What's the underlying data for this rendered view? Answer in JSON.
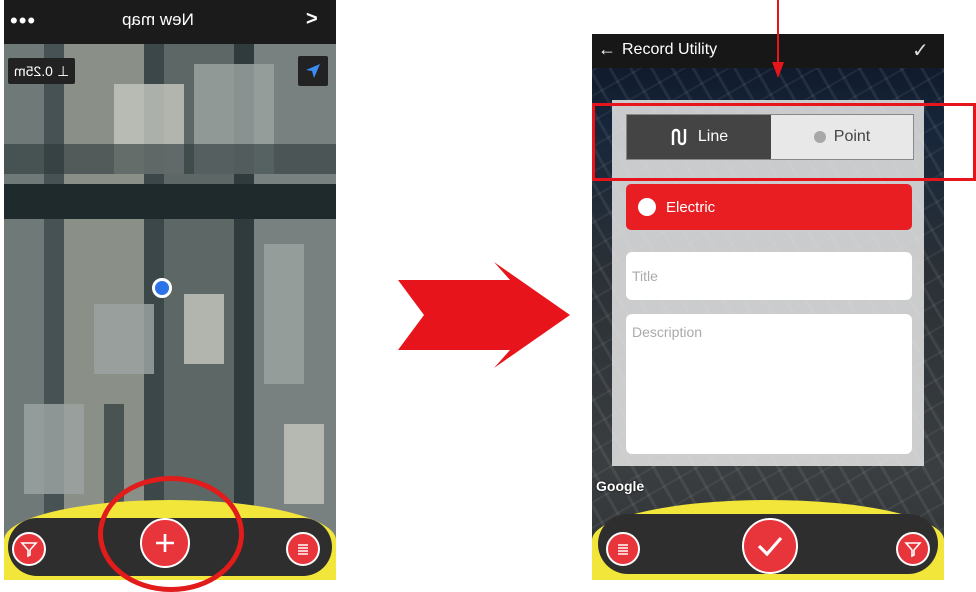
{
  "left_screen": {
    "header": {
      "menu_icon": "more-dots-icon",
      "title": "New map",
      "nav_icon": "chevron-right-icon"
    },
    "scale_label": "0.25m",
    "toolbar": {
      "filter_icon": "filter-icon",
      "add_icon": "plus-icon",
      "list_icon": "list-icon"
    }
  },
  "right_screen": {
    "header": {
      "back_icon": "arrow-left-icon",
      "title": "Record Utility",
      "confirm_icon": "check-icon"
    },
    "geometry_toggle": {
      "line_label": "Line",
      "point_label": "Point",
      "selected": "Line"
    },
    "utility_type": "Electric",
    "title_placeholder": "Title",
    "description_placeholder": "Description",
    "attribution": "Google",
    "toolbar": {
      "list_icon": "list-icon",
      "confirm_icon": "check-icon",
      "filter_icon": "filter-icon"
    }
  },
  "colors": {
    "accent_red": "#e8343b",
    "highlight_red": "#e21b1b",
    "toolbar_yellow": "#f3e63a",
    "location_blue": "#2c72e8"
  }
}
